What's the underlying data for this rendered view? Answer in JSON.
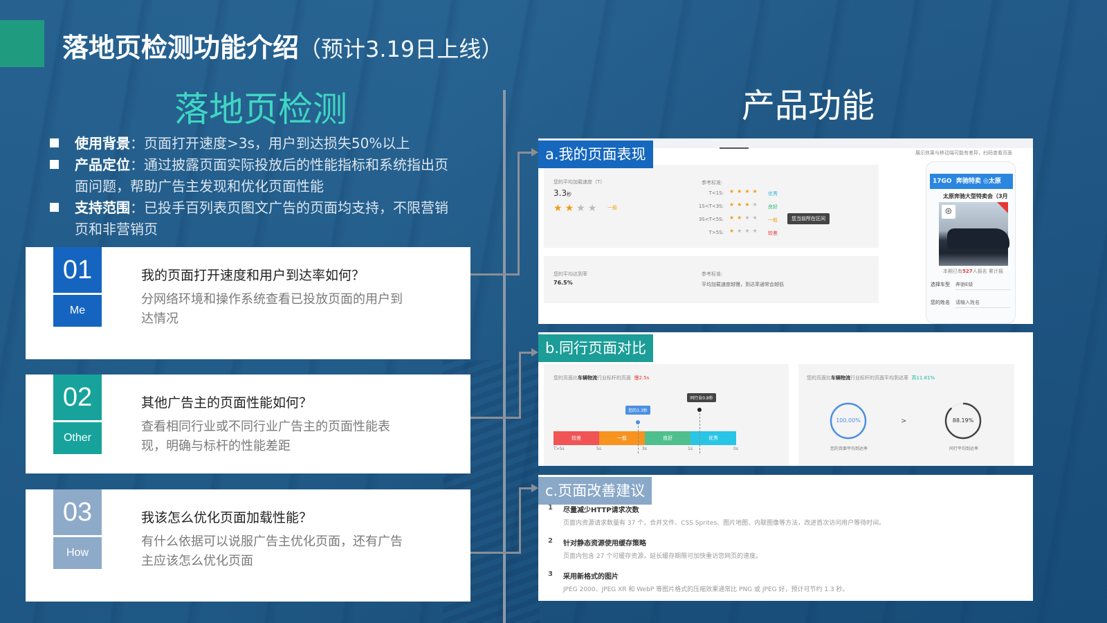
{
  "header": {
    "title": "落地页检测功能介绍",
    "subtitle": "（预计3.19日上线）"
  },
  "left": {
    "heading": "落地页检测",
    "bullets": [
      {
        "key": "使用背景",
        "text": "：页面打开速度>3s，用户到达损失50%以上"
      },
      {
        "key": "产品定位",
        "text": "：通过披露页面实际投放后的性能指标和系统指出页面问题，帮助广告主发现和优化页面性能"
      },
      {
        "key": "支持范围",
        "text": "：已投手百列表页图文广告的页面均支持，不限营销页和非营销页"
      }
    ],
    "cards": [
      {
        "num": "01",
        "tag": "Me",
        "question": "我的页面打开速度和用户到达率如何？",
        "desc": "分网络环境和操作系统查看已投放页面的用户到达情况"
      },
      {
        "num": "02",
        "tag": "Other",
        "question": "其他广告主的页面性能如何？",
        "desc": "查看相同行业或不同行业广告主的页面性能表现，明确与标杆的性能差距"
      },
      {
        "num": "03",
        "tag": "How",
        "question": "我该怎么优化页面加载性能？",
        "desc": "有什么依据可以说服广告主优化页面，还有广告主应该怎么优化页面"
      }
    ]
  },
  "right": {
    "heading": "产品功能",
    "panel_a": {
      "label": "a.我的页面表现",
      "note": "展示效果与移动端可能有差异，扫码查看页面",
      "speed_label": "您的平均加载速度（T）",
      "speed_value": "3.3",
      "speed_unit": "秒",
      "speed_stars": 2,
      "speed_stars_max": 4,
      "speed_rating": "一般",
      "ref_title": "参考标准:",
      "ref_rows": [
        {
          "cond": "T<1S:",
          "stars": 4,
          "level": "优秀",
          "color": "#29b6d8"
        },
        {
          "cond": "1S<T<3S:",
          "stars": 3,
          "level": "良好",
          "color": "#2bb673"
        },
        {
          "cond": "3S<T<5S:",
          "stars": 2,
          "level": "一般",
          "color": "#f39c12"
        },
        {
          "cond": "T>5S:",
          "stars": 1,
          "level": "较差",
          "color": "#e53935"
        }
      ],
      "tooltip": "您当前所在区间",
      "rate_label": "您的平均达到率",
      "rate_value": "76.5%",
      "ref2_title": "参考标准:",
      "ref2_text": "平均加载速度越慢，到达率通常会越低",
      "phone": {
        "brand": "17GO",
        "bar_title": "奔驰特卖",
        "city": "◎太原",
        "title": "太原奔驰大型特卖会（3月",
        "count_prefix": "本期已有",
        "count": "527",
        "count_suffix": "人报名  累计报",
        "fields": [
          {
            "label": "选择车型",
            "value": "奔驰E级"
          },
          {
            "label": "您的姓名",
            "value": "请输入姓名"
          }
        ]
      }
    },
    "panel_b": {
      "label": "b.同行页面对比",
      "speed_cmp_prefix": "您的页面比",
      "industry": "车辆物流",
      "speed_cmp_mid": "行业标杆的页面",
      "speed_cmp_diff": "慢2.5s",
      "segments": [
        {
          "label": "较差",
          "color": "#f05454"
        },
        {
          "label": "一般",
          "color": "#f7931e"
        },
        {
          "label": "良好",
          "color": "#4fc08d"
        },
        {
          "label": "优秀",
          "color": "#29c5e6"
        }
      ],
      "axis": [
        "T>5s",
        "5s",
        "3s",
        "1s",
        "0s"
      ],
      "my_marker": "您的3.3秒",
      "my_value_s": 3.3,
      "industry_marker": "同行业0.8秒",
      "industry_value_s": 0.8,
      "rate_cmp_prefix": "您的页面比",
      "rate_cmp_mid": "行业标杆的页面平均到达率",
      "rate_cmp_diff": "高11.81%",
      "my_rate": "100.00%",
      "my_rate_value": 100.0,
      "my_rate_label": "您的页面平均到达率",
      "compare_symbol": ">",
      "peer_rate": "88.19%",
      "peer_rate_value": 88.19,
      "peer_rate_label": "同行平均到达率"
    },
    "panel_c": {
      "label": "c.页面改善建议",
      "items": [
        {
          "n": "1",
          "title": "尽量减少HTTP请求次数",
          "desc": "页面内资源请求数量有 37 个，合并文件、CSS Sprites、图片地图、内联图像等方法，改进首次访问用户等待时间。"
        },
        {
          "n": "2",
          "title": "针对静态资源使用缓存策略",
          "desc": "页面内包含 27 个可缓存资源，延长缓存期限可加快重访您网页的速度。"
        },
        {
          "n": "3",
          "title": "采用新格式的图片",
          "desc": "JPEG 2000、JPEG XR 和 WebP 等图片格式的压缩效果通常比 PNG 或 JPEG 好，预计可节约 1.3 秒。"
        }
      ]
    }
  },
  "colors": {
    "background": "#1f5c8c",
    "accent_green": "#1f9b7f",
    "heading_teal": "#3fd6c2",
    "me_blue": "#1565c0",
    "other_teal": "#17a39c",
    "how_grey": "#8eaac9"
  }
}
